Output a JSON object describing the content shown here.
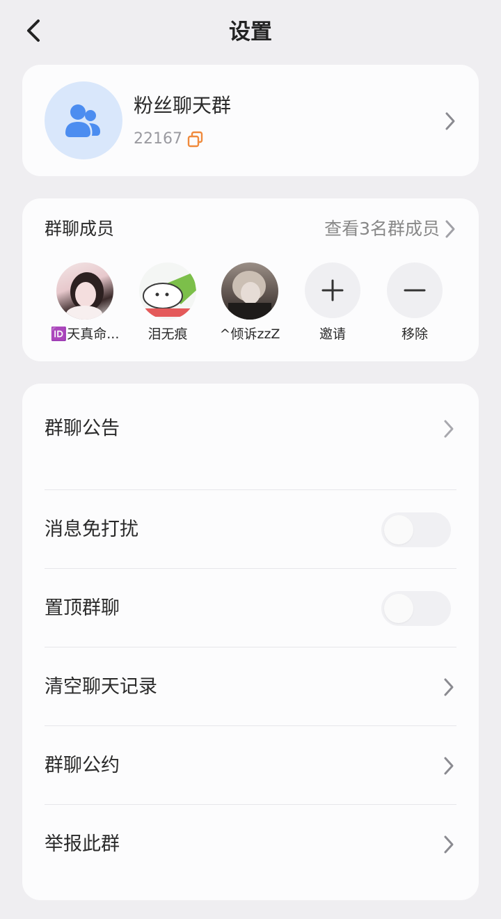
{
  "header": {
    "title": "设置"
  },
  "group": {
    "name": "粉丝聊天群",
    "id": "22167"
  },
  "members": {
    "title": "群聊成员",
    "view_all": "查看3名群成员",
    "list": [
      {
        "name": "🆔天真命..."
      },
      {
        "name": "泪无痕"
      },
      {
        "name": "^倾诉zzZ"
      }
    ],
    "invite_label": "邀请",
    "remove_label": "移除"
  },
  "settings": {
    "announcement": "群聊公告",
    "mute": "消息免打扰",
    "mute_on": false,
    "pin": "置顶群聊",
    "pin_on": false,
    "clear_history": "清空聊天记录",
    "rules": "群聊公约",
    "report": "举报此群"
  },
  "colors": {
    "accent_blue": "#4c8df0",
    "copy_orange": "#f08a3c"
  }
}
